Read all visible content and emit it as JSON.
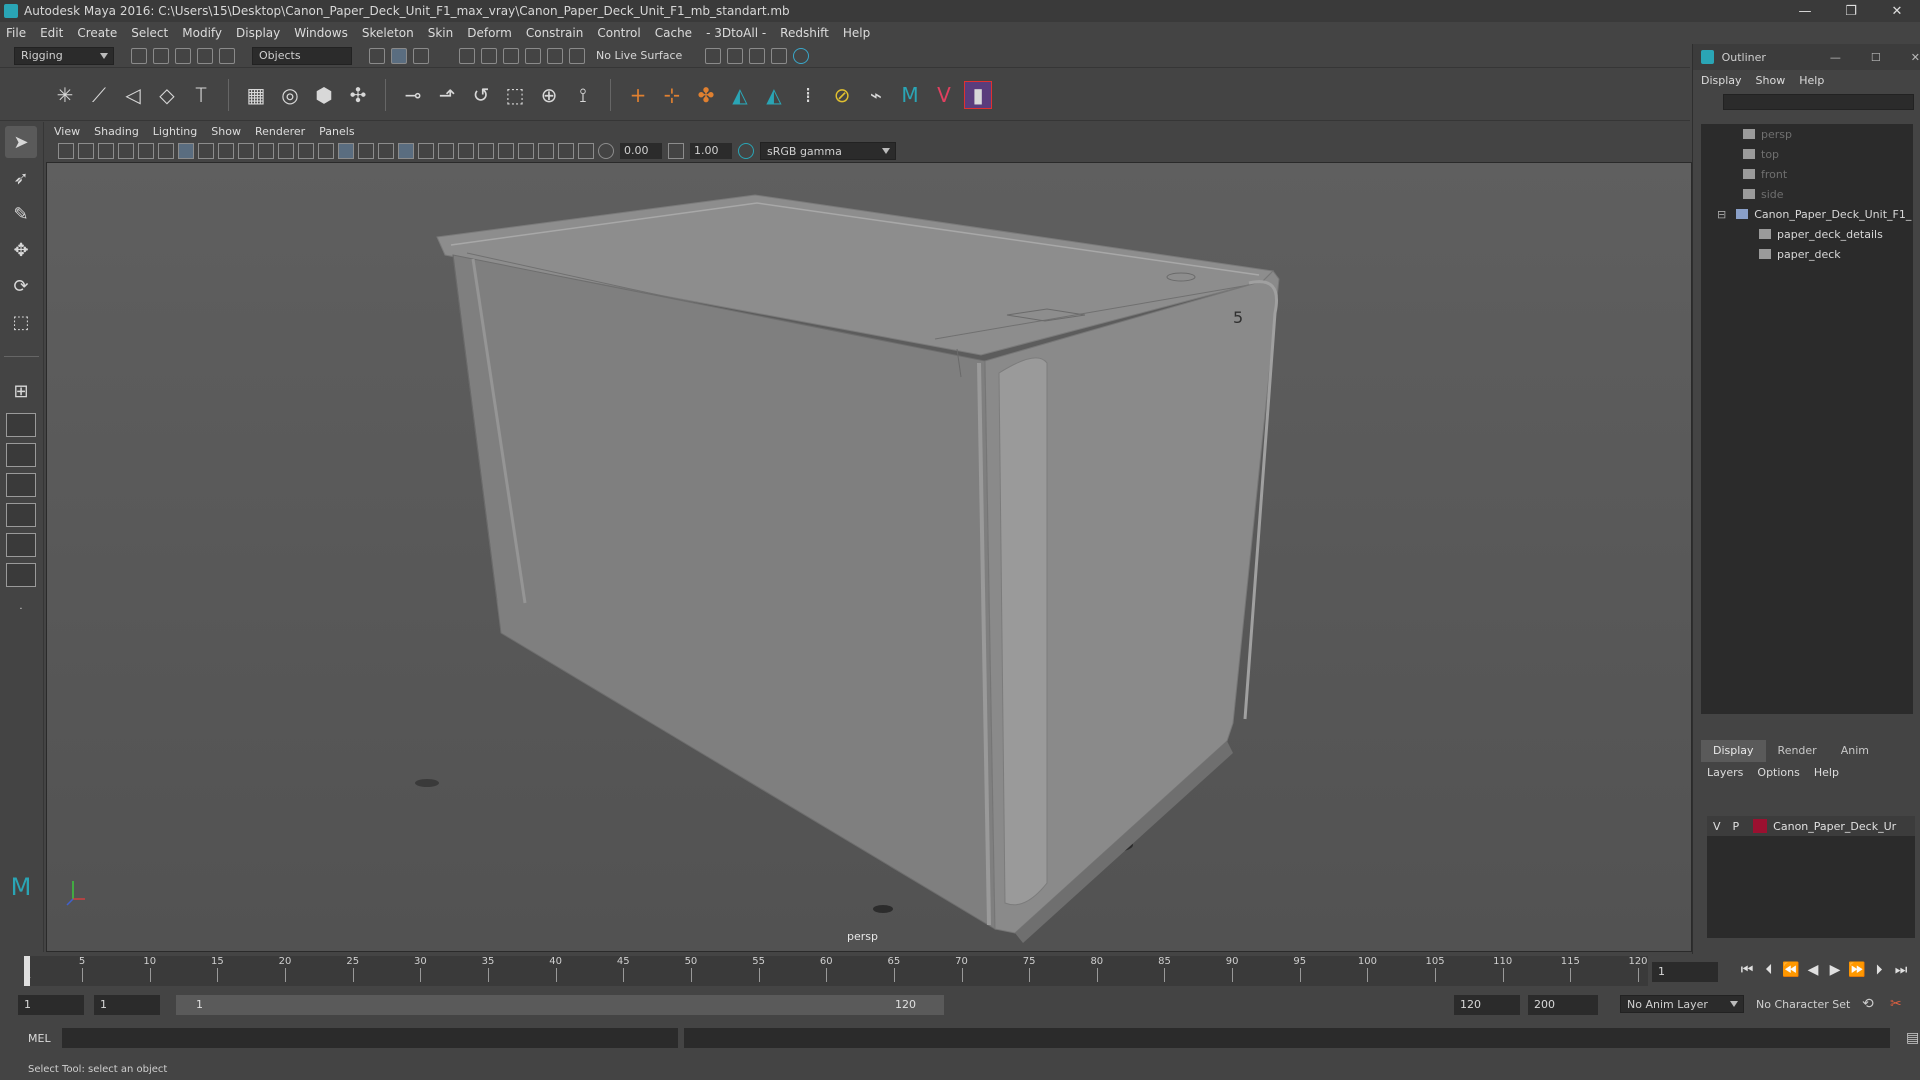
{
  "window": {
    "title": "Autodesk Maya 2016: C:\\Users\\15\\Desktop\\Canon_Paper_Deck_Unit_F1_max_vray\\Canon_Paper_Deck_Unit_F1_mb_standart.mb",
    "minimize": "—",
    "restore": "❐",
    "close": "✕"
  },
  "menubar": [
    "File",
    "Edit",
    "Create",
    "Select",
    "Modify",
    "Display",
    "Windows",
    "Skeleton",
    "Skin",
    "Deform",
    "Constrain",
    "Control",
    "Cache",
    "- 3DtoAll -",
    "Redshift",
    "Help"
  ],
  "statusline": {
    "menu_set": "Rigging",
    "selection_mode": "Objects",
    "live_surface": "No Live Surface"
  },
  "panel": {
    "menus": [
      "View",
      "Shading",
      "Lighting",
      "Show",
      "Renderer",
      "Panels"
    ],
    "near_value": "0.00",
    "far_value": "1.00",
    "color_space": "sRGB gamma",
    "camera_label": "persp"
  },
  "outliner": {
    "title": "Outliner",
    "menus": [
      "Display",
      "Show",
      "Help"
    ],
    "items": [
      {
        "label": "persp",
        "dim": true
      },
      {
        "label": "top",
        "dim": true
      },
      {
        "label": "front",
        "dim": true
      },
      {
        "label": "side",
        "dim": true
      },
      {
        "label": "Canon_Paper_Deck_Unit_F1_",
        "dim": false
      },
      {
        "label": "paper_deck_details",
        "dim": false
      },
      {
        "label": "paper_deck",
        "dim": false
      }
    ]
  },
  "layers": {
    "tabs": [
      "Display",
      "Render",
      "Anim"
    ],
    "menus": [
      "Layers",
      "Options",
      "Help"
    ],
    "row": {
      "v": "V",
      "p": "P",
      "name": "Canon_Paper_Deck_Ur",
      "color": "#9a1030"
    }
  },
  "timeline": {
    "ticks": [
      "5",
      "10",
      "15",
      "20",
      "25",
      "30",
      "35",
      "40",
      "45",
      "50",
      "55",
      "60",
      "65",
      "70",
      "75",
      "80",
      "85",
      "90",
      "95",
      "100",
      "105",
      "110",
      "115",
      "120"
    ],
    "start_mark": "1",
    "current_frame": "1"
  },
  "range": {
    "start": "1",
    "start_inner": "1",
    "range_start_label": "1",
    "range_end_label": "120",
    "end_inner": "120",
    "end": "200",
    "anim_layer": "No Anim Layer",
    "char_set": "No Character Set"
  },
  "cmdline": {
    "label": "MEL"
  },
  "helpline": {
    "text": "Select Tool: select an object"
  }
}
